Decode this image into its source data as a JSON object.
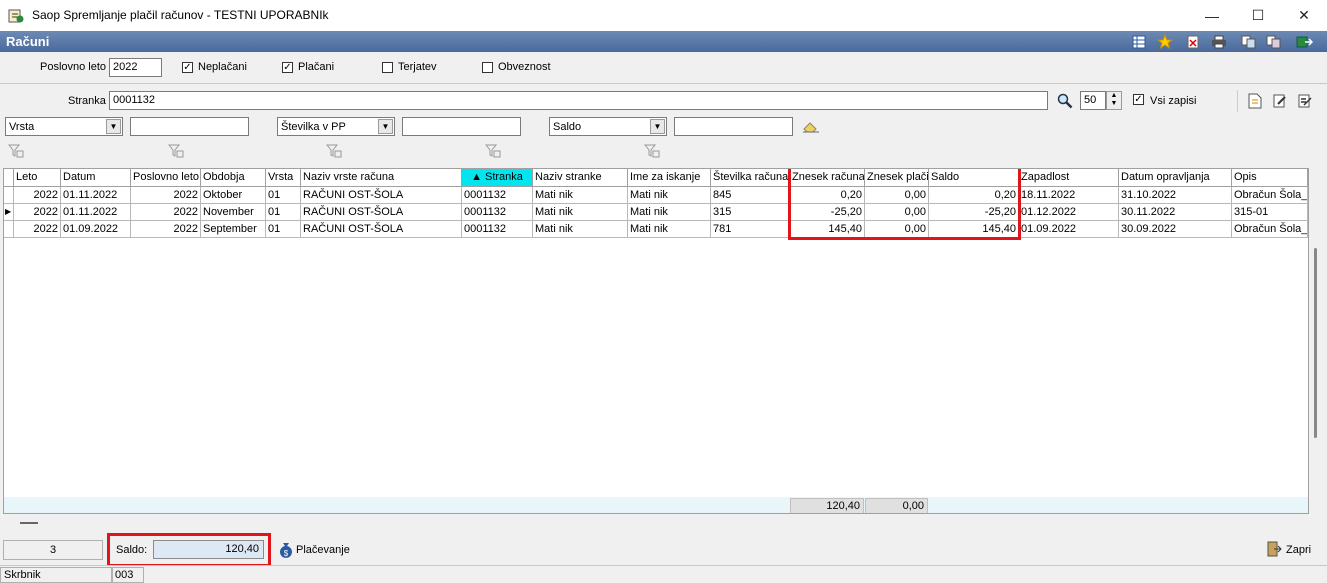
{
  "window": {
    "title": "Saop Spremljanje plačil računov - TESTNI UPORABNIk",
    "minimize": "—",
    "maximize": "☐",
    "close": "✕"
  },
  "header": {
    "title": "Računi",
    "icons": [
      "grid-icon",
      "star-icon",
      "delete-icon",
      "print-icon",
      "copy-icon",
      "copy2-icon",
      "exit-icon"
    ]
  },
  "filters": {
    "poslovno_leto_label": "Poslovno leto",
    "poslovno_leto_value": "2022",
    "neplacani_label": "Neplačani",
    "neplacani_checked": true,
    "placani_label": "Plačani",
    "placani_checked": true,
    "terjatev_label": "Terjatev",
    "terjatev_checked": false,
    "obveznost_label": "Obveznost",
    "obveznost_checked": false,
    "stranka_label": "Stranka",
    "stranka_value": "0001132",
    "count_value": "50",
    "vsi_zapisi_label": "Vsi zapisi",
    "vsi_zapisi_checked": true,
    "combo1": "Vrsta",
    "combo2": "Številka v PP",
    "combo3": "Saldo",
    "text1": "",
    "text2": "",
    "text3": ""
  },
  "table": {
    "columns": [
      "Leto",
      "Datum",
      "Poslovno leto",
      "Obdobja",
      "Vrsta",
      "Naziv vrste računa",
      "Stranka",
      "Naziv stranke",
      "Ime za iskanje",
      "Številka računa",
      "Znesek računa",
      "Znesek plačil",
      "Saldo",
      "Zapadlost",
      "Datum opravljanja",
      "Opis"
    ],
    "sorted_column": "Stranka",
    "rows": [
      [
        "2022",
        "01.11.2022",
        "2022",
        "Oktober",
        "01",
        "RAČUNI OST-ŠOLA",
        "0001132",
        "Mati nik",
        "Mati nik",
        "845",
        "0,20",
        "0,00",
        "0,20",
        "18.11.2022",
        "31.10.2022",
        "Obračun Šola_o"
      ],
      [
        "2022",
        "01.11.2022",
        "2022",
        "November",
        "01",
        "RAČUNI OST-ŠOLA",
        "0001132",
        "Mati nik",
        "Mati nik",
        "315",
        "-25,20",
        "0,00",
        "-25,20",
        "01.12.2022",
        "30.11.2022",
        "315-01"
      ],
      [
        "2022",
        "01.09.2022",
        "2022",
        "September",
        "01",
        "RAČUNI OST-ŠOLA",
        "0001132",
        "Mati nik",
        "Mati nik",
        "781",
        "145,40",
        "0,00",
        "145,40",
        "01.09.2022",
        "30.09.2022",
        "Obračun Šola_s"
      ]
    ],
    "current_row": 1,
    "totals": {
      "znesek_racuna": "120,40",
      "znesek_placil": "0,00"
    }
  },
  "bottom": {
    "count": "3",
    "saldo_label": "Saldo:",
    "saldo_value": "120,40",
    "placevanje_label": "Plačevanje",
    "zapri_label": "Zapri",
    "status_label": "Skrbnik",
    "status_value": "003"
  },
  "colors": {
    "accent_red": "#e0151b",
    "sorted_header": "#00e5ee",
    "header_band": "#5a78a8"
  }
}
